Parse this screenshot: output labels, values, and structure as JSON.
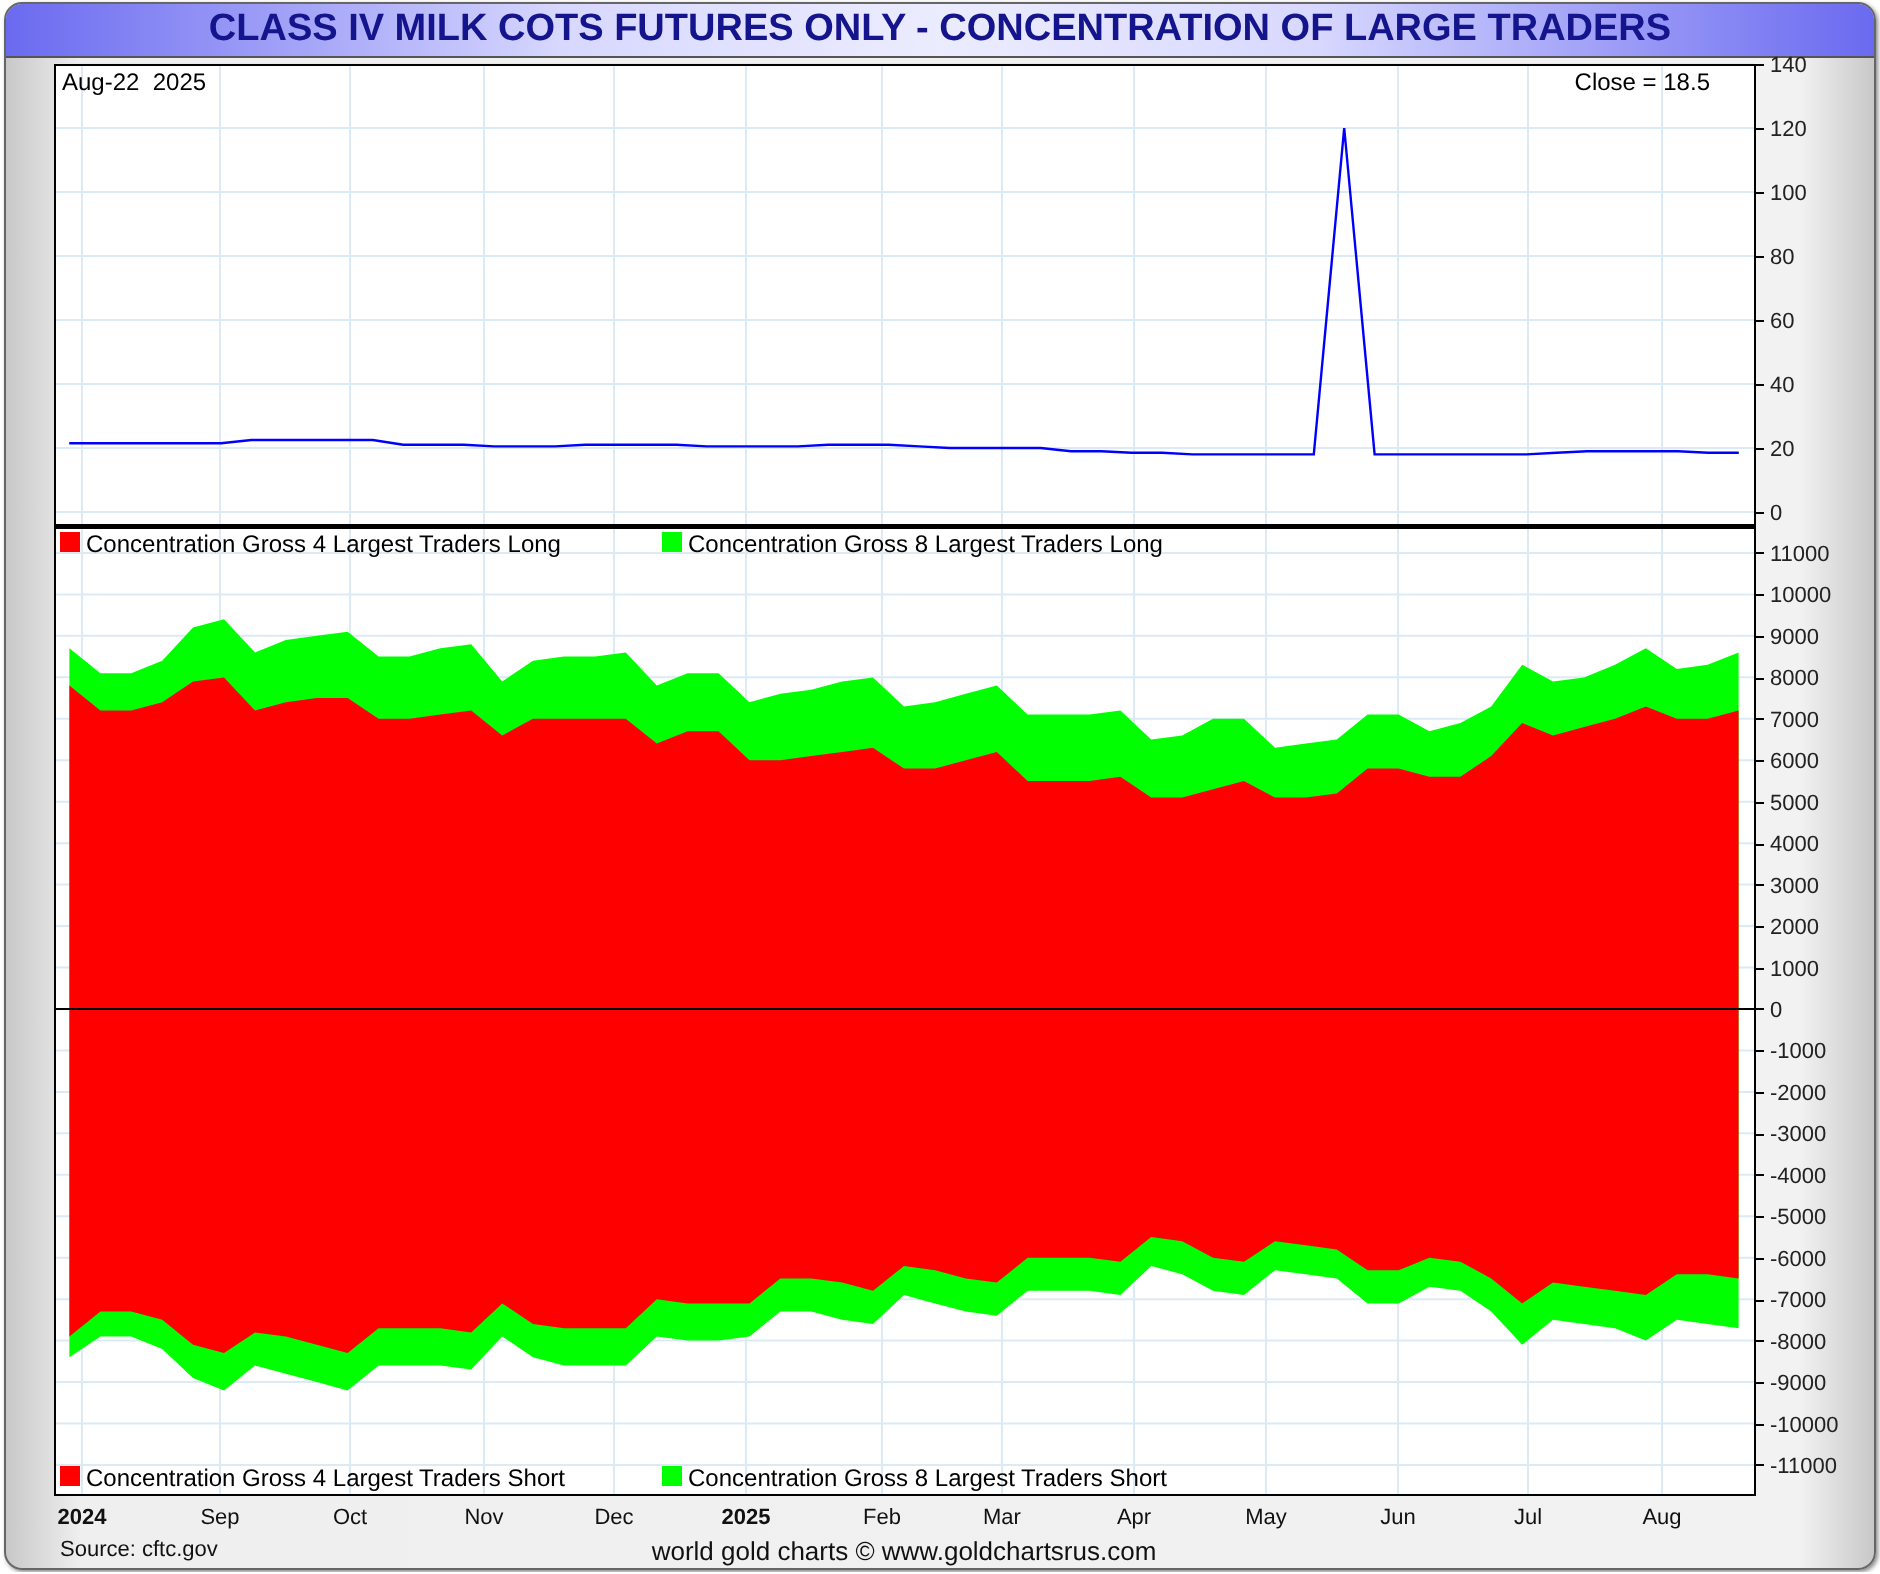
{
  "title": "CLASS IV MILK COTS FUTURES ONLY - CONCENTRATION OF LARGE TRADERS",
  "price_panel": {
    "date_label": "Aug-22  2025",
    "close_label": "Close = 18.5",
    "chart_data": {
      "type": "line",
      "grid": true,
      "ylim": [
        -3.75,
        140
      ],
      "yticks": [
        0,
        20,
        40,
        60,
        80,
        100,
        120,
        140
      ],
      "series": [
        {
          "color": "#0000ff",
          "values": [
            21.5,
            21.5,
            21.5,
            21.5,
            21.5,
            21.5,
            22.5,
            22.5,
            22.5,
            22.5,
            22.5,
            21,
            21,
            21,
            20.5,
            20.5,
            20.5,
            21,
            21,
            21,
            21,
            20.5,
            20.5,
            20.5,
            20.5,
            21,
            21,
            21,
            20.5,
            20,
            20,
            20,
            20,
            19,
            19,
            18.5,
            18.5,
            18,
            18,
            18,
            18,
            18,
            120,
            18,
            18,
            18,
            18,
            18,
            18,
            18.5,
            19,
            19,
            19,
            19,
            18.5,
            18.5
          ]
        }
      ]
    }
  },
  "positions_panel": {
    "chart_data": {
      "type": "area",
      "grid": true,
      "legend": "lower left",
      "ylim": [
        -11700,
        11650
      ],
      "yticks": [
        -11000,
        -10000,
        -9000,
        -8000,
        -7000,
        -6000,
        -5000,
        -4000,
        -3000,
        -2000,
        -1000,
        0,
        1000,
        2000,
        3000,
        4000,
        5000,
        6000,
        7000,
        8000,
        9000,
        10000,
        11000
      ],
      "series": [
        {
          "name": "Concentration Gross 8 Largest Traders Long",
          "color": "#00ff00",
          "values": [
            8700,
            8100,
            8100,
            8400,
            9200,
            9400,
            8600,
            8900,
            9000,
            9100,
            8500,
            8500,
            8700,
            8800,
            7900,
            8400,
            8500,
            8500,
            8600,
            7800,
            8100,
            8100,
            7400,
            7600,
            7700,
            7900,
            8000,
            7300,
            7400,
            7600,
            7800,
            7100,
            7100,
            7100,
            7200,
            6500,
            6600,
            7000,
            7000,
            6300,
            6400,
            6500,
            7100,
            7100,
            6700,
            6900,
            7300,
            8300,
            7900,
            8000,
            8300,
            8700,
            8200,
            8300,
            8600
          ]
        },
        {
          "name": "Concentration Gross 4 Largest Traders Long",
          "color": "#ff0000",
          "values": [
            7800,
            7200,
            7200,
            7400,
            7900,
            8000,
            7200,
            7400,
            7500,
            7500,
            7000,
            7000,
            7100,
            7200,
            6600,
            7000,
            7000,
            7000,
            7000,
            6400,
            6700,
            6700,
            6000,
            6000,
            6100,
            6200,
            6300,
            5800,
            5800,
            6000,
            6200,
            5500,
            5500,
            5500,
            5600,
            5100,
            5100,
            5300,
            5500,
            5100,
            5100,
            5200,
            5800,
            5800,
            5600,
            5600,
            6100,
            6900,
            6600,
            6800,
            7000,
            7300,
            7000,
            7000,
            7200
          ]
        },
        {
          "name": "Concentration Gross 8 Largest Traders Short",
          "color": "#00ff00",
          "values": [
            -8400,
            -7900,
            -7900,
            -8200,
            -8900,
            -9200,
            -8600,
            -8800,
            -9000,
            -9200,
            -8600,
            -8600,
            -8600,
            -8700,
            -7900,
            -8400,
            -8600,
            -8600,
            -8600,
            -7900,
            -8000,
            -8000,
            -7900,
            -7300,
            -7300,
            -7500,
            -7600,
            -6900,
            -7100,
            -7300,
            -7400,
            -6800,
            -6800,
            -6800,
            -6900,
            -6200,
            -6400,
            -6800,
            -6900,
            -6300,
            -6400,
            -6500,
            -7100,
            -7100,
            -6700,
            -6800,
            -7300,
            -8100,
            -7500,
            -7600,
            -7700,
            -8000,
            -7500,
            -7600,
            -7700
          ]
        },
        {
          "name": "Concentration Gross 4 Largest Traders Short",
          "color": "#ff0000",
          "values": [
            -7900,
            -7300,
            -7300,
            -7500,
            -8100,
            -8300,
            -7800,
            -7900,
            -8100,
            -8300,
            -7700,
            -7700,
            -7700,
            -7800,
            -7100,
            -7600,
            -7700,
            -7700,
            -7700,
            -7000,
            -7100,
            -7100,
            -7100,
            -6500,
            -6500,
            -6600,
            -6800,
            -6200,
            -6300,
            -6500,
            -6600,
            -6000,
            -6000,
            -6000,
            -6100,
            -5500,
            -5600,
            -6000,
            -6100,
            -5600,
            -5700,
            -5800,
            -6300,
            -6300,
            -6000,
            -6100,
            -6500,
            -7100,
            -6600,
            -6700,
            -6800,
            -6900,
            -6400,
            -6400,
            -6500
          ]
        }
      ]
    }
  },
  "time_axis": [
    {
      "label": "2024",
      "emphasis": true
    },
    {
      "label": "Sep",
      "emphasis": false
    },
    {
      "label": "Oct",
      "emphasis": false
    },
    {
      "label": "Nov",
      "emphasis": false
    },
    {
      "label": "Dec",
      "emphasis": false
    },
    {
      "label": "2025",
      "emphasis": true
    },
    {
      "label": "Feb",
      "emphasis": false
    },
    {
      "label": "Mar",
      "emphasis": false
    },
    {
      "label": "Apr",
      "emphasis": false
    },
    {
      "label": "May",
      "emphasis": false
    },
    {
      "label": "Jun",
      "emphasis": false
    },
    {
      "label": "Jul",
      "emphasis": false
    },
    {
      "label": "Aug",
      "emphasis": false
    }
  ],
  "footer": {
    "source": "Source: cftc.gov",
    "credit": "world gold charts © www.goldchartsrus.com"
  }
}
